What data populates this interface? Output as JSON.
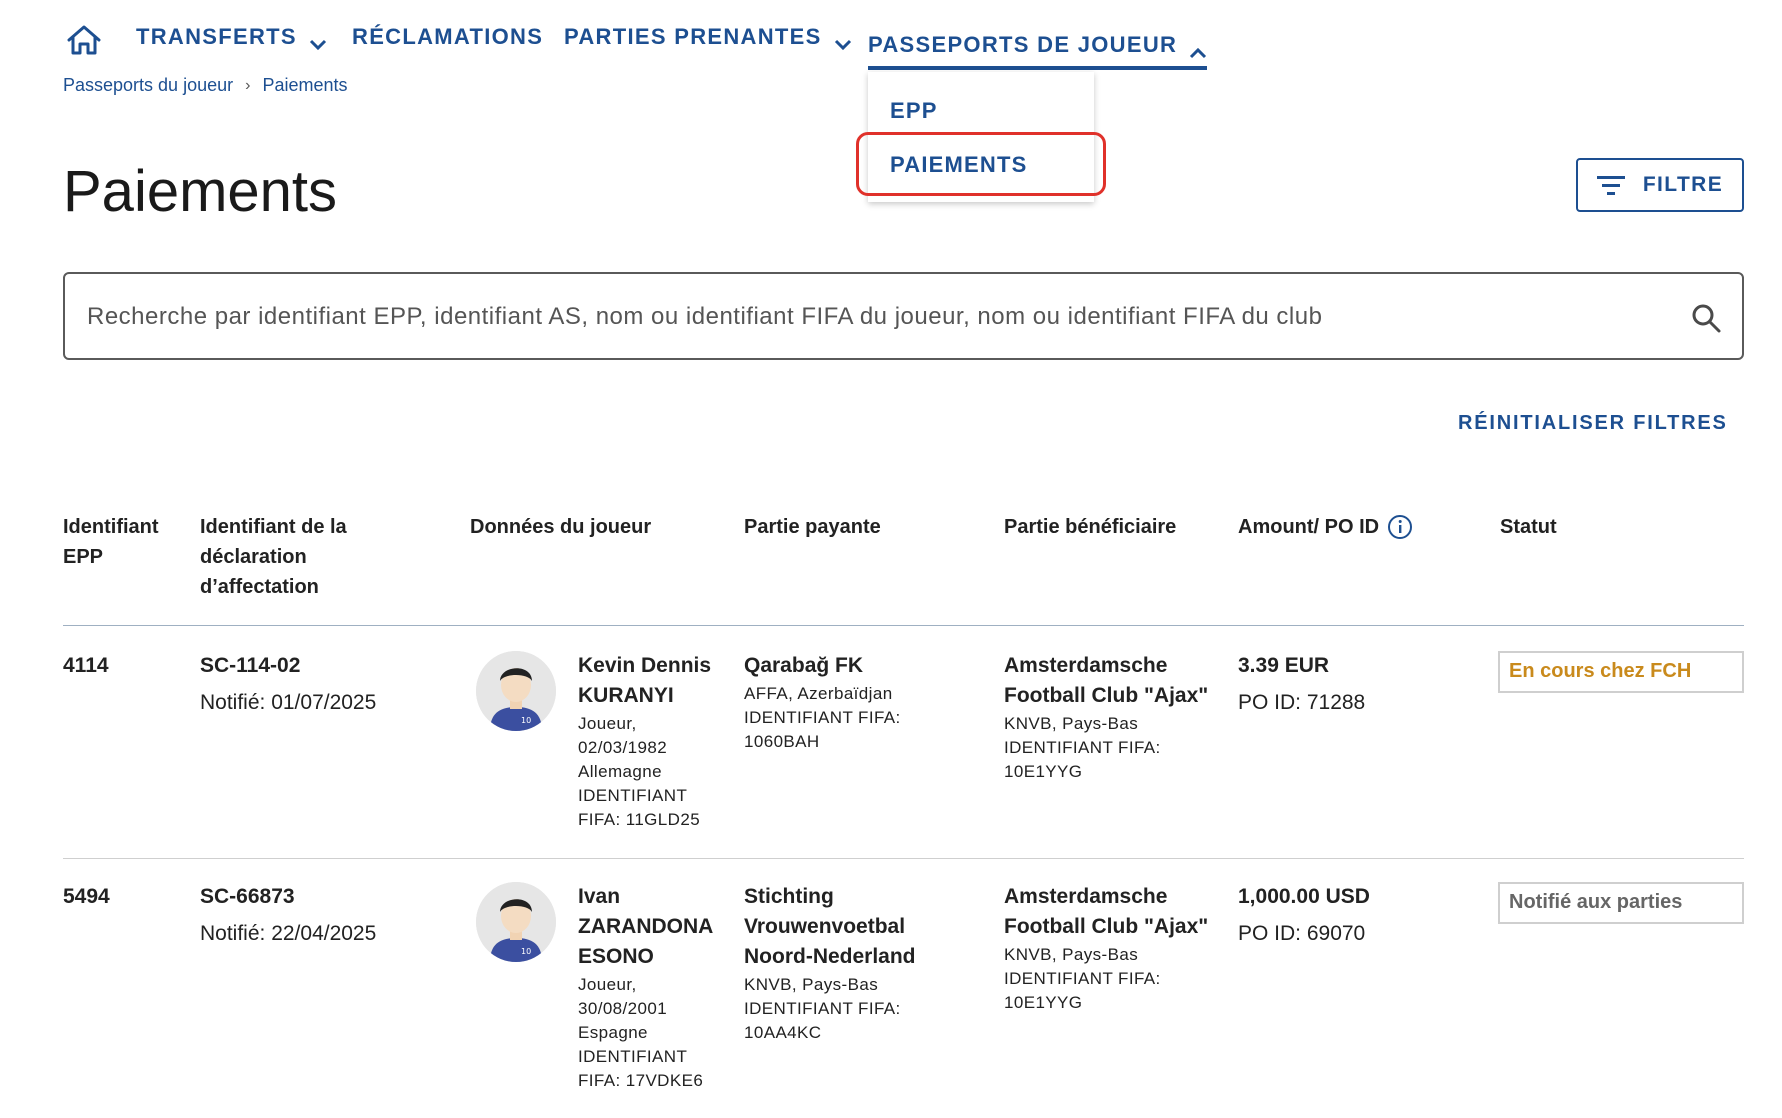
{
  "nav": {
    "items": [
      {
        "label": "TRANSFERTS"
      },
      {
        "label": "RÉCLAMATIONS"
      },
      {
        "label": "PARTIES PRENANTES"
      },
      {
        "label": "PASSEPORTS DE JOUEUR"
      }
    ],
    "dropdown": [
      {
        "label": "EPP"
      },
      {
        "label": "PAIEMENTS"
      }
    ]
  },
  "breadcrumb": {
    "parent": "Passeports du joueur",
    "current": "Paiements"
  },
  "page": {
    "title": "Paiements",
    "filter_label": "FILTRE",
    "search_placeholder": "Recherche par identifiant EPP, identifiant AS, nom ou identifiant FIFA du joueur, nom ou identifiant FIFA du club",
    "reset_label": "RÉINITIALISER FILTRES"
  },
  "table": {
    "headers": {
      "epp_line1": "Identifiant",
      "epp_line2": "EPP",
      "decl_line1": "Identifiant de la",
      "decl_line2": "déclaration",
      "decl_line3": "d’affectation",
      "player": "Données du joueur",
      "payer": "Partie payante",
      "beneficiary": "Partie bénéficiaire",
      "amount": "Amount/ PO ID",
      "status": "Statut"
    },
    "rows": [
      {
        "epp_id": "4114",
        "decl_id": "SC-114-02",
        "notified": "Notifié: 01/07/2025",
        "player_name_1": "Kevin Dennis",
        "player_name_2": "KURANYI",
        "player_role": "Joueur,",
        "player_dob": "02/03/1982",
        "player_country": "Allemagne",
        "player_fifa_1": "IDENTIFIANT",
        "player_fifa_2": "FIFA: 11GLD25",
        "jersey": "10",
        "payer_name": "Qarabağ FK",
        "payer_assoc": "AFFA, Azerbaïdjan",
        "payer_fifa_1": "IDENTIFIANT FIFA:",
        "payer_fifa_2": "1060BAH",
        "benef_name_1": "Amsterdamsche",
        "benef_name_2": "Football Club \"Ajax\"",
        "benef_assoc": "KNVB, Pays-Bas",
        "benef_fifa_1": "IDENTIFIANT FIFA:",
        "benef_fifa_2": "10E1YYG",
        "amount": "3.39 EUR",
        "po_id": "PO ID: 71288",
        "status": "En cours chez FCH"
      },
      {
        "epp_id": "5494",
        "decl_id": "SC-66873",
        "notified": "Notifié: 22/04/2025",
        "player_name_1": "Ivan",
        "player_name_2": "ZARANDONA",
        "player_name_3": "ESONO",
        "player_role": "Joueur,",
        "player_dob": "30/08/2001",
        "player_country": "Espagne",
        "player_fifa_1": "IDENTIFIANT",
        "player_fifa_2": "FIFA: 17VDKE6",
        "jersey": "10",
        "payer_name_1": "Stichting",
        "payer_name_2": "Vrouwenvoetbal",
        "payer_name_3": "Noord-Nederland",
        "payer_assoc": "KNVB, Pays-Bas",
        "payer_fifa_1": "IDENTIFIANT FIFA:",
        "payer_fifa_2": "10AA4KC",
        "benef_name_1": "Amsterdamsche",
        "benef_name_2": "Football Club \"Ajax\"",
        "benef_assoc": "KNVB, Pays-Bas",
        "benef_fifa_1": "IDENTIFIANT FIFA:",
        "benef_fifa_2": "10E1YYG",
        "amount": "1,000.00 USD",
        "po_id": "PO ID: 69070",
        "status": "Notifié aux parties"
      }
    ]
  },
  "colors": {
    "primary": "#1d4f91",
    "highlight": "#e0312a",
    "status_in_progress": "#c98a1c",
    "status_notified": "#666666"
  },
  "icons": {
    "home": "home-icon",
    "filter": "filter-lines-icon",
    "search": "search-icon",
    "info": "info-icon",
    "chevron_down": "chevron-down-icon",
    "chevron_up": "chevron-up-icon",
    "avatar": "player-avatar-icon"
  }
}
